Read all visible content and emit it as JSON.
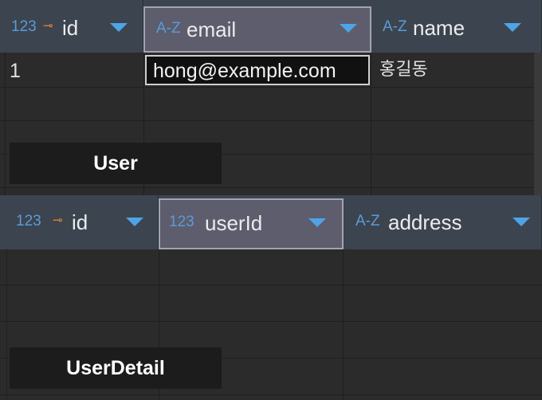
{
  "user_table": {
    "label": "User",
    "columns": [
      {
        "type": "123",
        "key_icon": "⊸",
        "name": "id",
        "selected": false
      },
      {
        "type": "A-Z",
        "name": "email",
        "selected": true
      },
      {
        "type": "A-Z",
        "name": "name",
        "selected": false
      }
    ],
    "rows": [
      {
        "id": "1",
        "email": "hong@example.com",
        "name": "홍길동"
      }
    ]
  },
  "userdetail_table": {
    "label": "UserDetail",
    "columns": [
      {
        "type": "123",
        "key_icon": "⊸",
        "name": "id",
        "selected": false
      },
      {
        "type": "123",
        "name": "userId",
        "selected": true
      },
      {
        "type": "A-Z",
        "name": "address",
        "selected": false
      }
    ]
  },
  "colors": {
    "header_bg": "#3c4450",
    "selected_header_bg": "#5d5d6e",
    "type_icon": "#5b9bd5",
    "key_icon": "#e8892f",
    "sort_arrow": "#4ea4e6",
    "grid_bg": "#2b2b2b"
  }
}
